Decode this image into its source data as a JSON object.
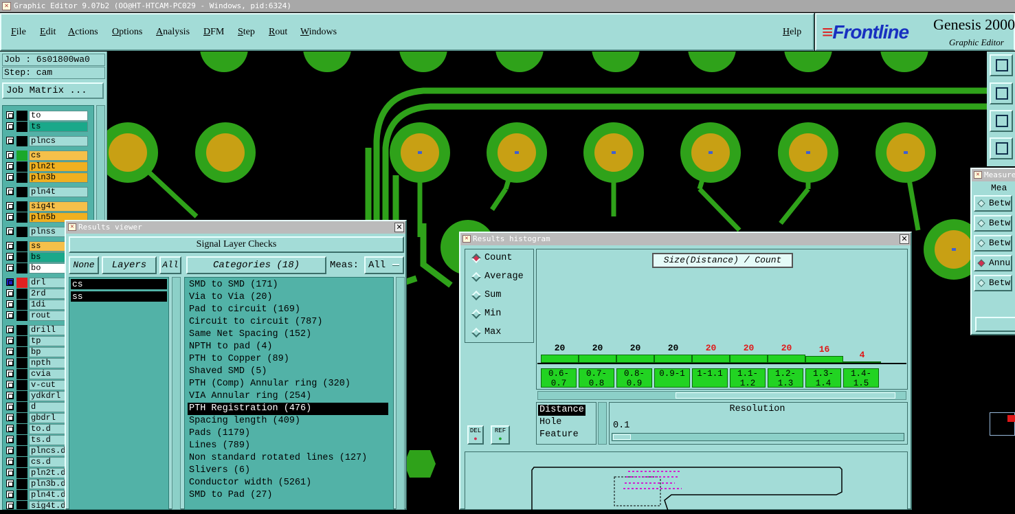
{
  "app": {
    "title": "Graphic Editor 9.07b2 (OO@HT-HTCAM-PC029 - Windows, pid:6324)"
  },
  "menu": {
    "items": [
      "File",
      "Edit",
      "Actions",
      "Options",
      "Analysis",
      "DFM",
      "Step",
      "Rout",
      "Windows"
    ],
    "help": "Help"
  },
  "brand": {
    "logo": "Frontline",
    "product": "Genesis 2000",
    "subtitle": "Graphic Editor"
  },
  "job": {
    "job_label": "Job : 6s01800wa0",
    "step_label": "Step: cam",
    "job_matrix_button": "Job Matrix ..."
  },
  "layers": [
    {
      "name": "to",
      "color": "#000000",
      "bg": "#ffffff"
    },
    {
      "name": "ts",
      "color": "#000000",
      "bg": "#1aa88a"
    },
    {
      "name": "plncs",
      "color": "#000000",
      "bg": "#a3dcd7"
    },
    {
      "name": "cs",
      "color": "#1aa82a",
      "bg": "#f5c04a"
    },
    {
      "name": "pln2t",
      "color": "#000000",
      "bg": "#f0b020"
    },
    {
      "name": "pln3b",
      "color": "#000000",
      "bg": "#f0b020"
    },
    {
      "name": "pln4t",
      "color": "#000000",
      "bg": "#a3dcd7"
    },
    {
      "name": "sig4t",
      "color": "#000000",
      "bg": "#f5c04a"
    },
    {
      "name": "pln5b",
      "color": "#000000",
      "bg": "#f0b020"
    },
    {
      "name": "plnss",
      "color": "#000000",
      "bg": "#a3dcd7"
    },
    {
      "name": "ss",
      "color": "#000000",
      "bg": "#f5c04a"
    },
    {
      "name": "bs",
      "color": "#000000",
      "bg": "#1aa88a"
    },
    {
      "name": "bo",
      "color": "#000000",
      "bg": "#ffffff"
    },
    {
      "name": "drl",
      "color": "#e02020",
      "bg": "#a3dcd7"
    },
    {
      "name": "2rd",
      "color": "#000000",
      "bg": "#a3dcd7"
    },
    {
      "name": "1di",
      "color": "#000000",
      "bg": "#a3dcd7"
    },
    {
      "name": "rout",
      "color": "#000000",
      "bg": "#a3dcd7"
    },
    {
      "name": "drill",
      "color": "#000000",
      "bg": "#a3dcd7"
    },
    {
      "name": "tp",
      "color": "#000000",
      "bg": "#a3dcd7"
    },
    {
      "name": "bp",
      "color": "#000000",
      "bg": "#a3dcd7"
    },
    {
      "name": "npth",
      "color": "#000000",
      "bg": "#a3dcd7"
    },
    {
      "name": "cvia",
      "color": "#000000",
      "bg": "#a3dcd7"
    },
    {
      "name": "v-cut",
      "color": "#000000",
      "bg": "#a3dcd7"
    },
    {
      "name": "ydkdrl",
      "color": "#000000",
      "bg": "#a3dcd7"
    },
    {
      "name": "d",
      "color": "#000000",
      "bg": "#a3dcd7"
    },
    {
      "name": "gbdrl",
      "color": "#000000",
      "bg": "#a3dcd7"
    },
    {
      "name": "to.d",
      "color": "#000000",
      "bg": "#a3dcd7"
    },
    {
      "name": "ts.d",
      "color": "#000000",
      "bg": "#a3dcd7"
    },
    {
      "name": "plncs.d",
      "color": "#000000",
      "bg": "#a3dcd7"
    },
    {
      "name": "cs.d",
      "color": "#000000",
      "bg": "#a3dcd7"
    },
    {
      "name": "pln2t.d",
      "color": "#000000",
      "bg": "#a3dcd7"
    },
    {
      "name": "pln3b.d",
      "color": "#000000",
      "bg": "#a3dcd7"
    },
    {
      "name": "pln4t.d",
      "color": "#000000",
      "bg": "#a3dcd7"
    },
    {
      "name": "sig4t.d",
      "color": "#000000",
      "bg": "#a3dcd7"
    }
  ],
  "results_viewer": {
    "title": "Results viewer",
    "header": "Signal Layer Checks",
    "none_button": "None",
    "layers_button": "Layers",
    "all_button": "All",
    "categories_button": "Categories (18)",
    "meas_label": "Meas:",
    "meas_value": "All",
    "selected_layers": [
      "cs",
      "ss"
    ],
    "categories": [
      "SMD to SMD (171)",
      "Via to Via (20)",
      "Pad to circuit (169)",
      "Circuit to circuit (787)",
      "Same Net Spacing (152)",
      "NPTH to pad (4)",
      "PTH to Copper (89)",
      "Shaved SMD (5)",
      "PTH (Comp) Annular ring (320)",
      "VIA Annular ring (254)",
      "PTH Registration (476)",
      "Spacing length (409)",
      "Pads (1179)",
      "Lines (789)",
      "Non standard rotated lines (127)",
      "Slivers (6)",
      "Conductor width (5261)",
      "SMD to Pad (27)"
    ],
    "selected_category": "PTH Registration (476)"
  },
  "histogram": {
    "title": "Results histogram",
    "chart_title": "Size(Distance) / Count",
    "modes": [
      "Count",
      "Average",
      "Sum",
      "Min",
      "Max"
    ],
    "selected_mode": "Count",
    "bins": [
      {
        "label": "0.6-0.7",
        "count": 20,
        "highlight": false
      },
      {
        "label": "0.7-0.8",
        "count": 20,
        "highlight": false
      },
      {
        "label": "0.8-0.9",
        "count": 20,
        "highlight": false
      },
      {
        "label": "0.9-1",
        "count": 20,
        "highlight": false
      },
      {
        "label": "1-1.1",
        "count": 20,
        "highlight": true
      },
      {
        "label": "1.1-1.2",
        "count": 20,
        "highlight": true
      },
      {
        "label": "1.2-1.3",
        "count": 20,
        "highlight": true
      },
      {
        "label": "1.3-1.4",
        "count": 16,
        "highlight": true
      },
      {
        "label": "1.4-1.5",
        "count": 4,
        "highlight": true
      }
    ],
    "size_types": [
      "Distance",
      "Hole",
      "Feature"
    ],
    "selected_size_type": "Distance",
    "resolution_label": "Resolution",
    "resolution_value": "0.1",
    "del_button": "DEL",
    "ref_button": "REF"
  },
  "measure": {
    "title": "Measure",
    "header": "Mea",
    "options": [
      "Betw",
      "Betw",
      "Betw",
      "Annu",
      "Betw"
    ],
    "selected_index": 3
  },
  "colors": {
    "panel": "#a3dcd7",
    "list": "#52b2a7",
    "copper_trace": "#2fa21a",
    "pad_gold": "#c8a014",
    "bar_green": "#22d322",
    "highlight_red": "#e01818"
  }
}
